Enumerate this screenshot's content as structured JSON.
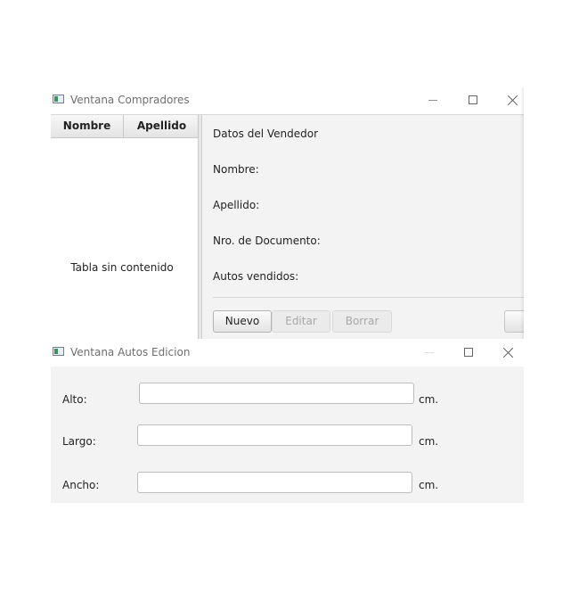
{
  "window_compradores": {
    "title": "Ventana Compradores",
    "table": {
      "columns": [
        "Nombre",
        "Apellido"
      ],
      "empty_text": "Tabla sin contenido"
    },
    "details": {
      "heading": "Datos del Vendedor",
      "nombre_label": "Nombre:",
      "apellido_label": "Apellido:",
      "documento_label": "Nro. de Documento:",
      "autos_label": "Autos vendidos:"
    },
    "buttons": {
      "nuevo": "Nuevo",
      "editar": "Editar",
      "borrar": "Borrar"
    }
  },
  "window_autos": {
    "title": "Ventana Autos Edicion",
    "fields": {
      "alto_label": "Alto:",
      "alto_value": "",
      "largo_label": "Largo:",
      "largo_value": "",
      "ancho_label": "Ancho:",
      "ancho_value": "",
      "unit": "cm."
    }
  },
  "icons": {
    "app": "app-window-icon",
    "minimize": "minimize-icon",
    "maximize": "maximize-icon",
    "close": "close-icon"
  }
}
